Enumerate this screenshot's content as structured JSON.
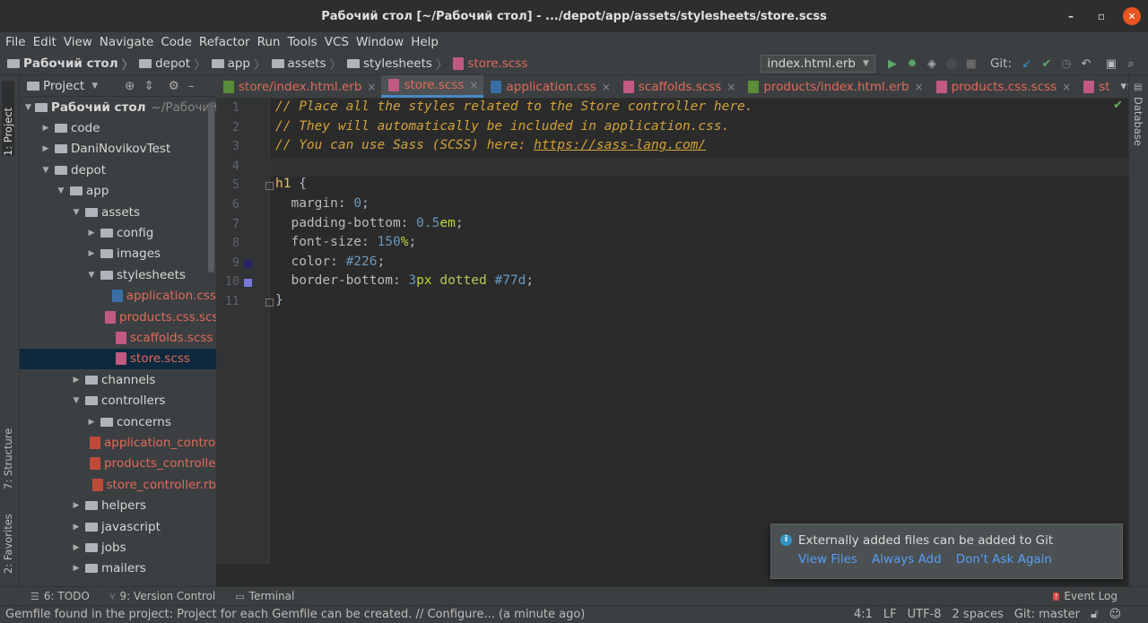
{
  "window": {
    "title": "Рабочий стол [~/Рабочий стол] - .../depot/app/assets/stylesheets/store.scss"
  },
  "menu": [
    "File",
    "Edit",
    "View",
    "Navigate",
    "Code",
    "Refactor",
    "Run",
    "Tools",
    "VCS",
    "Window",
    "Help"
  ],
  "breadcrumbs": [
    "Рабочий стол",
    "depot",
    "app",
    "assets",
    "stylesheets",
    "store.scss"
  ],
  "toolbar": {
    "run_config": "index.html.erb",
    "git_label": "Git:"
  },
  "left_strip": {
    "project": "1: Project",
    "structure": "7: Structure",
    "favorites": "2: Favorites"
  },
  "right_strip": {
    "database": "Database"
  },
  "project_panel": {
    "title": "Project",
    "nodes": [
      {
        "label": "Рабочий стол",
        "extra": "~/Рабочий с",
        "indent": 0,
        "arrow": "▼",
        "kind": "folder",
        "bold": true
      },
      {
        "label": "code",
        "indent": 1,
        "arrow": "▶",
        "kind": "folder"
      },
      {
        "label": "DaniNovikovTest",
        "indent": 1,
        "arrow": "▶",
        "kind": "folder"
      },
      {
        "label": "depot",
        "indent": 1,
        "arrow": "▼",
        "kind": "folder"
      },
      {
        "label": "app",
        "indent": 2,
        "arrow": "▼",
        "kind": "folder"
      },
      {
        "label": "assets",
        "indent": 3,
        "arrow": "▼",
        "kind": "folder"
      },
      {
        "label": "config",
        "indent": 4,
        "arrow": "▶",
        "kind": "folder"
      },
      {
        "label": "images",
        "indent": 4,
        "arrow": "▶",
        "kind": "folder"
      },
      {
        "label": "stylesheets",
        "indent": 4,
        "arrow": "▼",
        "kind": "folder"
      },
      {
        "label": "application.css",
        "indent": 5,
        "arrow": "",
        "kind": "css",
        "red": true
      },
      {
        "label": "products.css.scss",
        "indent": 5,
        "arrow": "",
        "kind": "scss",
        "red": true
      },
      {
        "label": "scaffolds.scss",
        "indent": 5,
        "arrow": "",
        "kind": "scss",
        "red": true
      },
      {
        "label": "store.scss",
        "indent": 5,
        "arrow": "",
        "kind": "scss",
        "red": true,
        "selected": true
      },
      {
        "label": "channels",
        "indent": 3,
        "arrow": "▶",
        "kind": "folder"
      },
      {
        "label": "controllers",
        "indent": 3,
        "arrow": "▼",
        "kind": "folder"
      },
      {
        "label": "concerns",
        "indent": 4,
        "arrow": "▶",
        "kind": "folder"
      },
      {
        "label": "application_controller.rb",
        "indent": 4,
        "arrow": "",
        "kind": "rb",
        "red": true
      },
      {
        "label": "products_controller.rb",
        "indent": 4,
        "arrow": "",
        "kind": "rb",
        "red": true
      },
      {
        "label": "store_controller.rb",
        "indent": 4,
        "arrow": "",
        "kind": "rb",
        "red": true
      },
      {
        "label": "helpers",
        "indent": 3,
        "arrow": "▶",
        "kind": "folder"
      },
      {
        "label": "javascript",
        "indent": 3,
        "arrow": "▶",
        "kind": "folder"
      },
      {
        "label": "jobs",
        "indent": 3,
        "arrow": "▶",
        "kind": "folder"
      },
      {
        "label": "mailers",
        "indent": 3,
        "arrow": "▶",
        "kind": "folder"
      }
    ]
  },
  "tabs": [
    {
      "label": "store/index.html.erb",
      "icon": "erb"
    },
    {
      "label": "store.scss",
      "icon": "scss",
      "active": true
    },
    {
      "label": "application.css",
      "icon": "css"
    },
    {
      "label": "scaffolds.scss",
      "icon": "scss"
    },
    {
      "label": "products/index.html.erb",
      "icon": "erb"
    },
    {
      "label": "products.css.scss",
      "icon": "scss"
    },
    {
      "label": "st",
      "icon": "scss"
    }
  ],
  "editor": {
    "line_numbers": [
      "1",
      "2",
      "3",
      "4",
      "5",
      "6",
      "7",
      "8",
      "9",
      "10",
      "11"
    ],
    "current_line": 4,
    "swatches": [
      {
        "line": 9,
        "color": "#222266"
      },
      {
        "line": 10,
        "color": "#7777dd"
      }
    ],
    "lines": [
      [
        {
          "t": "// Place all the styles related to the Store controller here.",
          "c": "cm"
        }
      ],
      [
        {
          "t": "// They will automatically be included in application.css.",
          "c": "cm"
        }
      ],
      [
        {
          "t": "// You can use Sass (SCSS) here: ",
          "c": "cm"
        },
        {
          "t": "https://sass-lang.com/",
          "c": "link"
        }
      ],
      [],
      [
        {
          "t": "h1",
          "c": "sel"
        },
        {
          "t": " {",
          "c": "p"
        }
      ],
      [
        {
          "t": "  margin: ",
          "c": "prop"
        },
        {
          "t": "0",
          "c": "num"
        },
        {
          "t": ";",
          "c": "p"
        }
      ],
      [
        {
          "t": "  padding-bottom: ",
          "c": "prop"
        },
        {
          "t": "0.5",
          "c": "num"
        },
        {
          "t": "em",
          "c": "unit"
        },
        {
          "t": ";",
          "c": "p"
        }
      ],
      [
        {
          "t": "  font-size: ",
          "c": "prop"
        },
        {
          "t": "150",
          "c": "num"
        },
        {
          "t": "%",
          "c": "unit"
        },
        {
          "t": ";",
          "c": "p"
        }
      ],
      [
        {
          "t": "  color: ",
          "c": "prop"
        },
        {
          "t": "#226",
          "c": "hex"
        },
        {
          "t": ";",
          "c": "p"
        }
      ],
      [
        {
          "t": "  border-bottom: ",
          "c": "prop"
        },
        {
          "t": "3",
          "c": "num"
        },
        {
          "t": "px",
          "c": "unit"
        },
        {
          "t": " ",
          "c": "p"
        },
        {
          "t": "dotted",
          "c": "kw"
        },
        {
          "t": " ",
          "c": "p"
        },
        {
          "t": "#77d",
          "c": "hex"
        },
        {
          "t": ";",
          "c": "p"
        }
      ],
      [
        {
          "t": "}",
          "c": "p"
        }
      ]
    ]
  },
  "notification": {
    "message": "Externally added files can be added to Git",
    "actions": [
      "View Files",
      "Always Add",
      "Don't Ask Again"
    ]
  },
  "bottom_tools": {
    "todo": "6: TODO",
    "vcs": "9: Version Control",
    "terminal": "Terminal",
    "event_log": "Event Log"
  },
  "status": {
    "message": "Gemfile found in the project: Project for each Gemfile can be created. // Configure... (a minute ago)",
    "position": "4:1",
    "line_sep": "LF",
    "encoding": "UTF-8",
    "indent": "2 spaces",
    "git": "Git: master"
  }
}
